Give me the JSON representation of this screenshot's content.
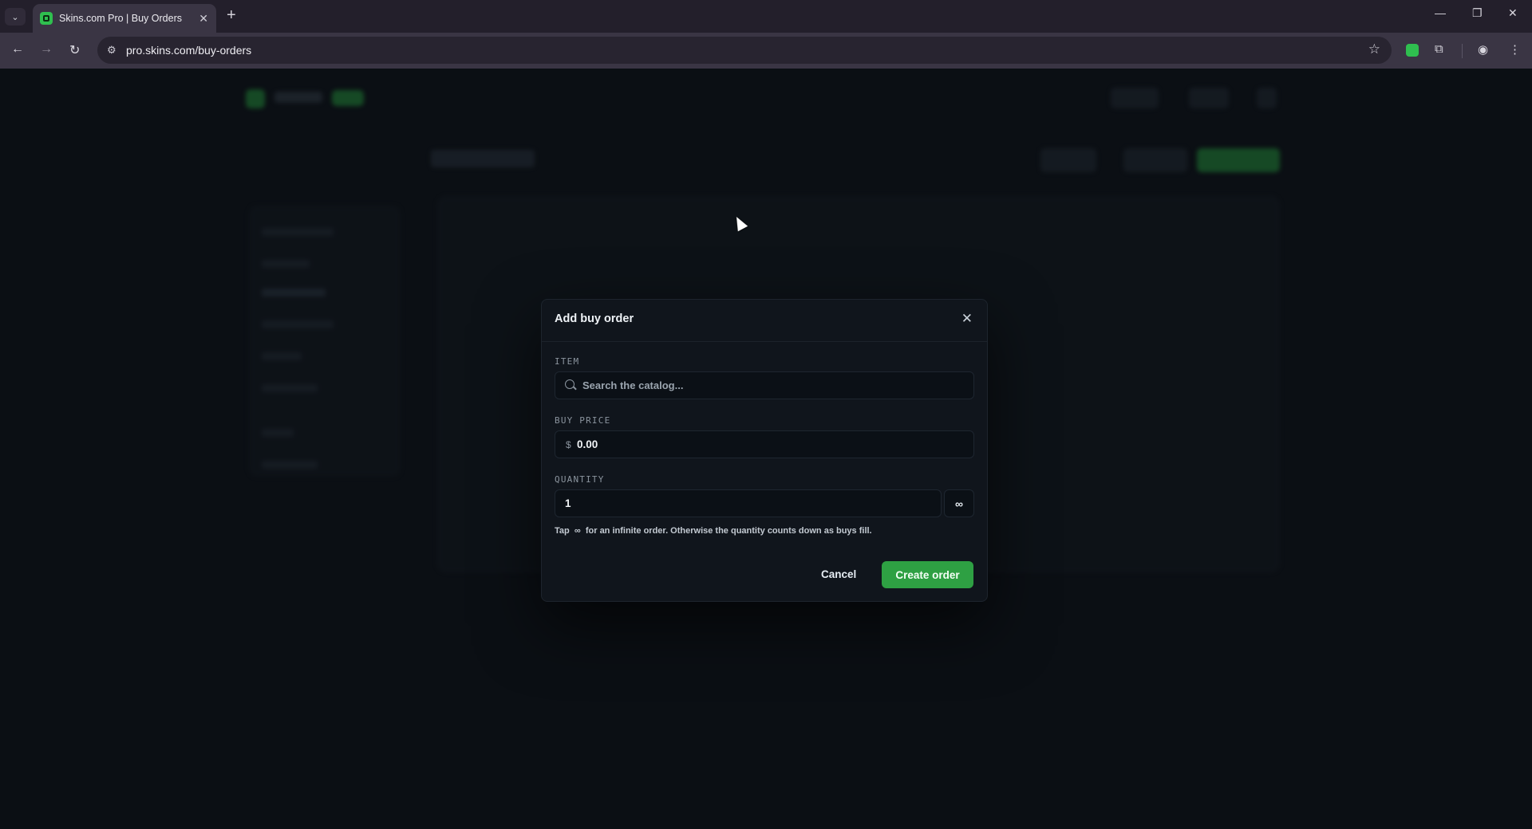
{
  "browser": {
    "tab_title": "Skins.com Pro | Buy Orders",
    "url": "pro.skins.com/buy-orders",
    "tab_close_glyph": "✕",
    "new_tab_glyph": "+",
    "icons": {
      "tab_list": "chevron-down-icon",
      "back": "arrow-left-icon",
      "forward": "arrow-right-icon",
      "reload": "reload-icon",
      "site_info": "tune-icon",
      "bookmark": "star-icon",
      "extensions": "puzzle-icon",
      "profile": "profile-icon",
      "menu": "more-vertical-icon"
    }
  },
  "modal": {
    "title": "Add buy order",
    "item": {
      "label": "ITEM",
      "placeholder": "Search the catalog..."
    },
    "buy_price": {
      "label": "BUY PRICE",
      "currency": "$",
      "value": "0.00"
    },
    "quantity": {
      "label": "QUANTITY",
      "value": "1",
      "infinite_glyph": "∞"
    },
    "hint": {
      "pre": "Tap",
      "glyph": "∞",
      "post": "for an infinite order. Otherwise the quantity counts down as buys fill."
    },
    "cancel_label": "Cancel",
    "create_label": "Create order"
  },
  "colors": {
    "accent": "#2ea043",
    "background": "#0b0f14",
    "modal_bg": "#10151c"
  }
}
